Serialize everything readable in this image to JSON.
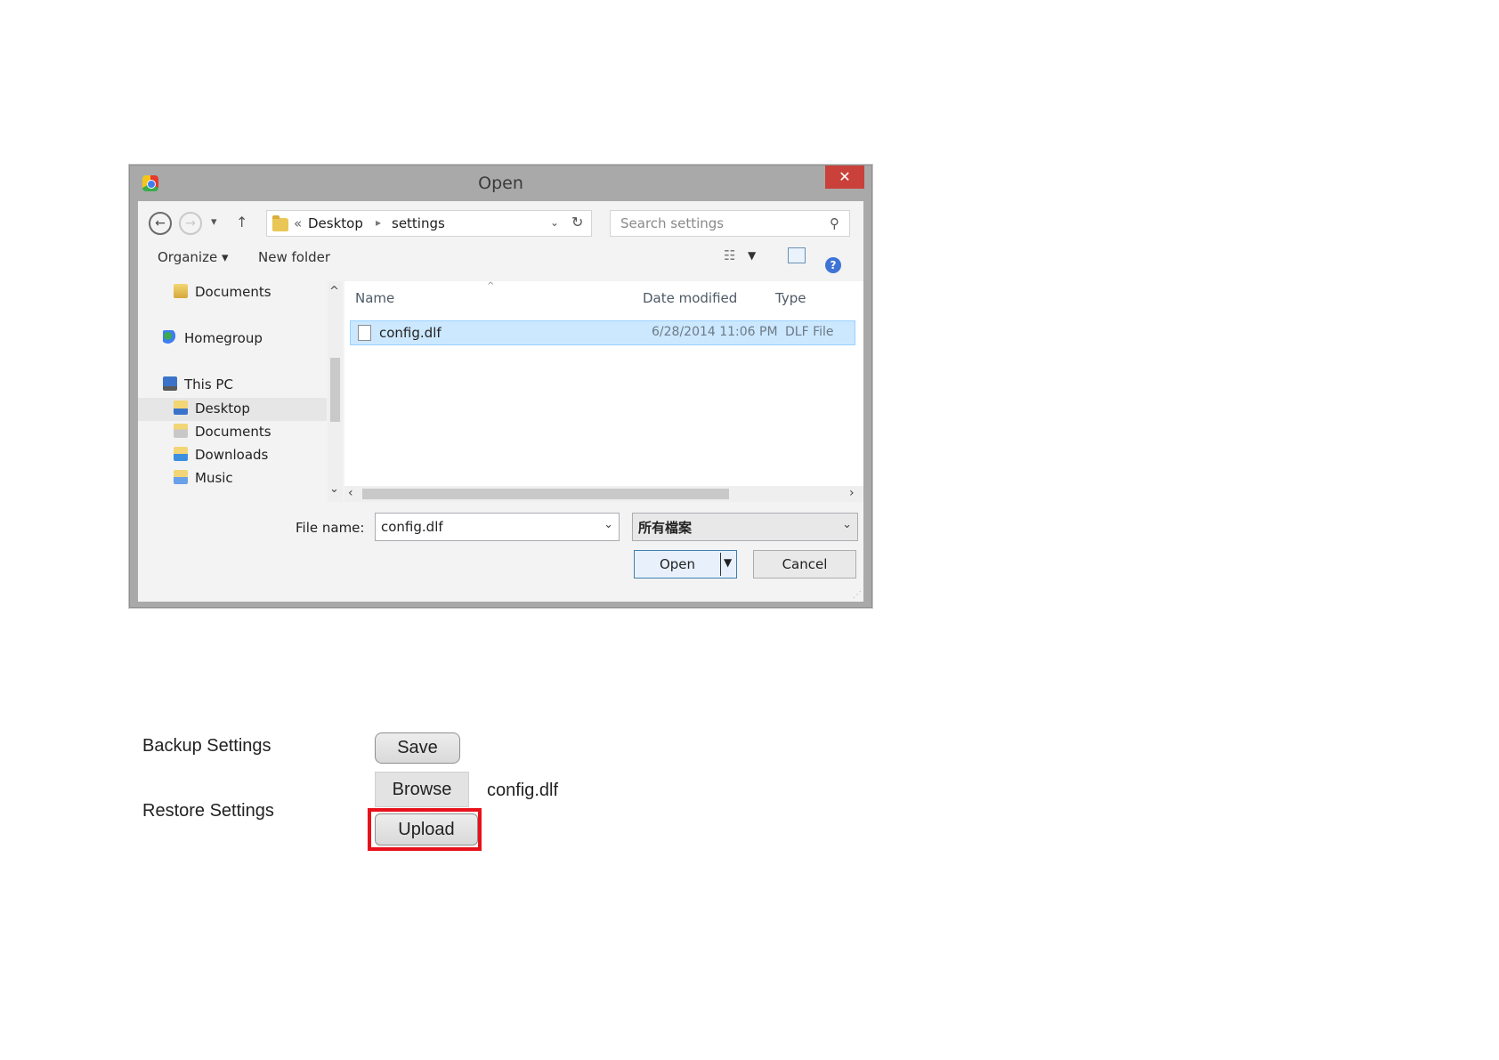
{
  "dialog": {
    "title": "Open",
    "close_glyph": "✕",
    "breadcrumb": {
      "overflow": "«",
      "separator": "▸",
      "items": [
        "Desktop",
        "settings"
      ]
    },
    "search_placeholder": "Search settings",
    "toolbar": {
      "organize_label": "Organize ▾",
      "new_folder_label": "New folder",
      "help_glyph": "?"
    },
    "nav_items": [
      {
        "label": "Documents",
        "icon": "folder-icon"
      },
      {
        "label": "Homegroup",
        "icon": "homegroup-icon"
      },
      {
        "label": "This PC",
        "icon": "computer-icon"
      },
      {
        "label": "Desktop",
        "icon": "desktop-folder-icon"
      },
      {
        "label": "Documents",
        "icon": "documents-folder-icon"
      },
      {
        "label": "Downloads",
        "icon": "downloads-folder-icon"
      },
      {
        "label": "Music",
        "icon": "music-folder-icon"
      }
    ],
    "columns": {
      "name": "Name",
      "date_modified": "Date modified",
      "type": "Type"
    },
    "files": [
      {
        "name": "config.dlf",
        "date_modified": "6/28/2014 11:06 PM",
        "type": "DLF File"
      }
    ],
    "file_name_label": "File name:",
    "file_name_value": "config.dlf",
    "file_type_filter": "所有檔案",
    "open_label": "Open",
    "cancel_label": "Cancel",
    "colors": {
      "frame": "#a9a9a9",
      "close": "#c9413a",
      "selection": "#cce8ff"
    }
  },
  "form": {
    "backup_label": "Backup Settings",
    "save_label": "Save",
    "restore_label": "Restore Settings",
    "browse_label": "Browse",
    "chosen_file": "config.dlf",
    "upload_label": "Upload",
    "highlight_color": "#e8111b"
  }
}
